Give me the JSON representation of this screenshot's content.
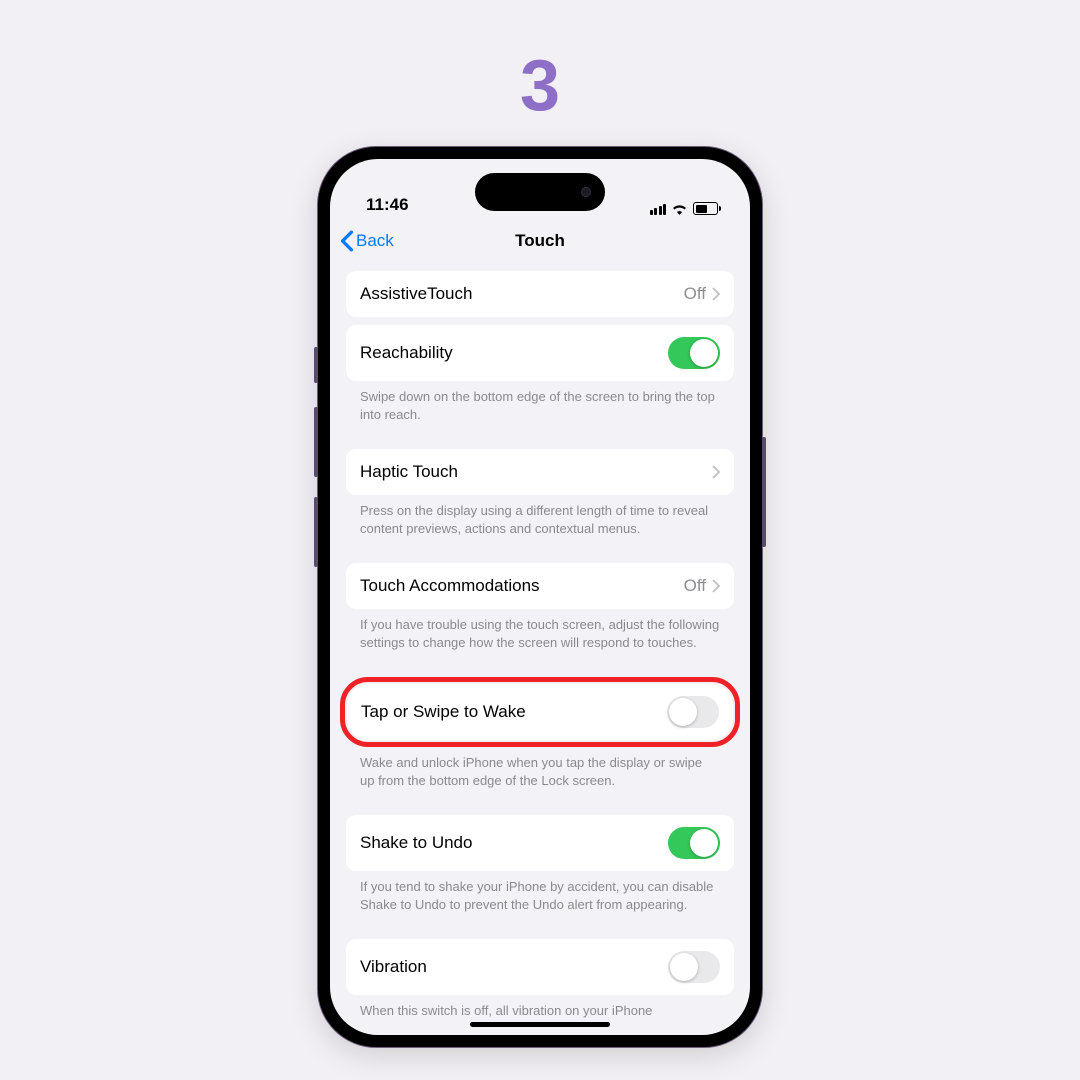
{
  "step_number": "3",
  "statusbar": {
    "time": "11:46"
  },
  "nav": {
    "back": "Back",
    "title": "Touch"
  },
  "rows": {
    "assistive": {
      "label": "AssistiveTouch",
      "value": "Off"
    },
    "reachability": {
      "label": "Reachability",
      "on": true,
      "footer": "Swipe down on the bottom edge of the screen to bring the top into reach."
    },
    "haptic": {
      "label": "Haptic Touch",
      "footer": "Press on the display using a different length of time to reveal content previews, actions and contextual menus."
    },
    "accommodations": {
      "label": "Touch Accommodations",
      "value": "Off",
      "footer": "If you have trouble using the touch screen, adjust the following settings to change how the screen will respond to touches."
    },
    "tapwake": {
      "label": "Tap or Swipe to Wake",
      "on": false,
      "footer": "Wake and unlock iPhone when you tap the display or swipe up from the bottom edge of the Lock screen."
    },
    "shake": {
      "label": "Shake to Undo",
      "on": true,
      "footer": "If you tend to shake your iPhone by accident, you can disable Shake to Undo to prevent the Undo alert from appearing."
    },
    "vibration": {
      "label": "Vibration",
      "on": false,
      "footer": "When this switch is off, all vibration on your iPhone"
    }
  }
}
